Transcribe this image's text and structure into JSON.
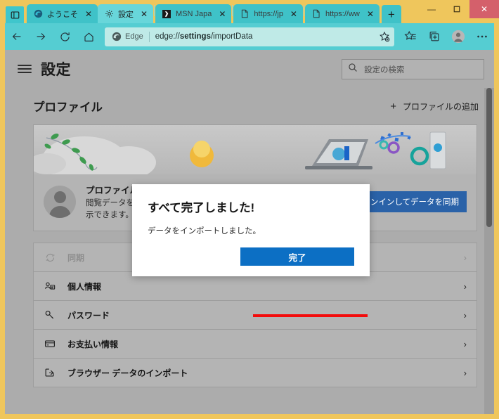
{
  "window": {
    "controls": {
      "minimize": "—",
      "maximize": "❐",
      "close": "✕"
    }
  },
  "tabstrip": {
    "tab_search_icon": "tab-search-icon",
    "new_tab_label": "+",
    "tabs": [
      {
        "title": "ようこそ",
        "icon": "edge-logo-icon",
        "close": "✕",
        "active": false
      },
      {
        "title": "設定",
        "icon": "gear-icon",
        "close": "✕",
        "active": true
      },
      {
        "title": "MSN Japa",
        "icon": "msn-icon",
        "close": "✕",
        "active": false
      },
      {
        "title": "https://jp",
        "icon": "page-icon",
        "close": "✕",
        "active": false
      },
      {
        "title": "https://ww",
        "icon": "page-icon",
        "close": "✕",
        "active": false
      }
    ]
  },
  "toolbar": {
    "back_icon": "back-arrow-icon",
    "forward_icon": "forward-arrow-icon",
    "reload_icon": "reload-icon",
    "home_icon": "home-icon",
    "edge_label": "Edge",
    "url_prefix": "edge://",
    "url_bold": "settings",
    "url_suffix": "/importData",
    "favorite_icon": "add-favorite-icon",
    "collections_icon": "favorites-hub-icon",
    "split_icon": "collections-icon",
    "profile_icon": "profile-avatar-icon",
    "more_icon": "more-settings-icon"
  },
  "settings_header": {
    "menu_icon": "hamburger-menu-icon",
    "title": "設定",
    "search_icon": "search-icon",
    "search_placeholder": "設定の検索",
    "search_value": ""
  },
  "profiles_section": {
    "title": "プロファイル",
    "add_profile_label": "プロファイルの追加",
    "add_profile_plus": "+",
    "card": {
      "avatar_icon": "profile-avatar-icon",
      "name": "プロファイル 1",
      "description_line1": "閲覧データを",
      "description_line2": "示できます。",
      "signin_button": "サインインしてデータを同期"
    }
  },
  "settings_list": [
    {
      "icon": "sync-icon",
      "label": "同期",
      "chevron": "›",
      "disabled": true
    },
    {
      "icon": "person-card-icon",
      "label": "個人情報",
      "chevron": "›",
      "disabled": false
    },
    {
      "icon": "key-icon",
      "label": "パスワード",
      "chevron": "›",
      "disabled": false
    },
    {
      "icon": "card-icon",
      "label": "お支払い情報",
      "chevron": "›",
      "disabled": false
    },
    {
      "icon": "import-icon",
      "label": "ブラウザー データのインポート",
      "chevron": "›",
      "disabled": false
    }
  ],
  "dialog": {
    "title": "すべて完了しました!",
    "body": "データをインポートしました。",
    "ok_button": "完了"
  },
  "annotation": {
    "underline_color": "#F30C0C"
  },
  "colors": {
    "window_frame": "#EFC65C",
    "toolbar": "#55CDD2",
    "tab_inactive": "#3FC2C8",
    "tab_active": "#68D6DA",
    "page_background": "#ACACAC",
    "accent_button": "#0C6FC4",
    "signin_button": "#2A62A8",
    "close_button": "#D4606B"
  }
}
